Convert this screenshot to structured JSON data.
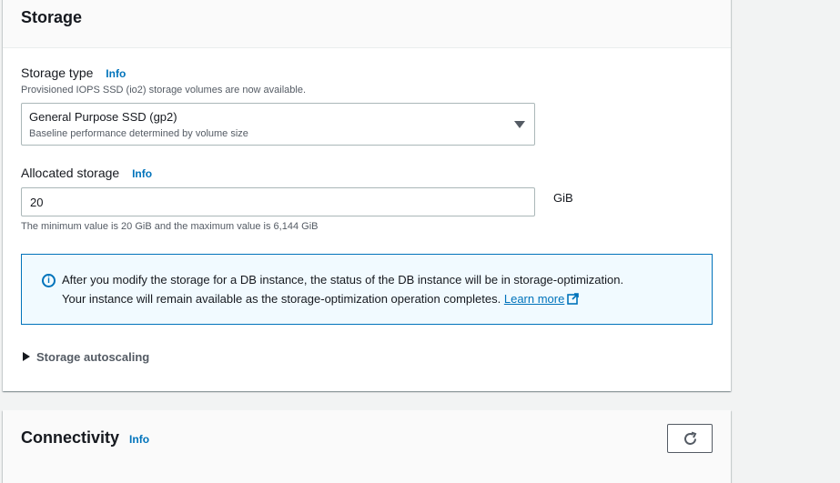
{
  "storage": {
    "title": "Storage",
    "storage_type": {
      "label": "Storage type",
      "info": "Info",
      "description": "Provisioned IOPS SSD (io2) storage volumes are now available.",
      "selected": "General Purpose SSD (gp2)",
      "selected_description": "Baseline performance determined by volume size"
    },
    "allocated_storage": {
      "label": "Allocated storage",
      "info": "Info",
      "value": "20",
      "unit": "GiB",
      "constraint": "The minimum value is 20 GiB and the maximum value is 6,144 GiB"
    },
    "alert": {
      "icon": "info-circle-icon",
      "line1": "After you modify the storage for a DB instance, the status of the DB instance will be in storage-optimization.",
      "line2": "Your instance will remain available as the storage-optimization operation completes.",
      "link": "Learn more"
    },
    "autoscaling": {
      "label": "Storage autoscaling"
    }
  },
  "connectivity": {
    "title": "Connectivity",
    "info": "Info",
    "refresh_icon": "refresh-icon"
  },
  "colors": {
    "link": "#0073bb",
    "alert_bg": "#f1faff",
    "page_bg": "#f2f3f3"
  }
}
